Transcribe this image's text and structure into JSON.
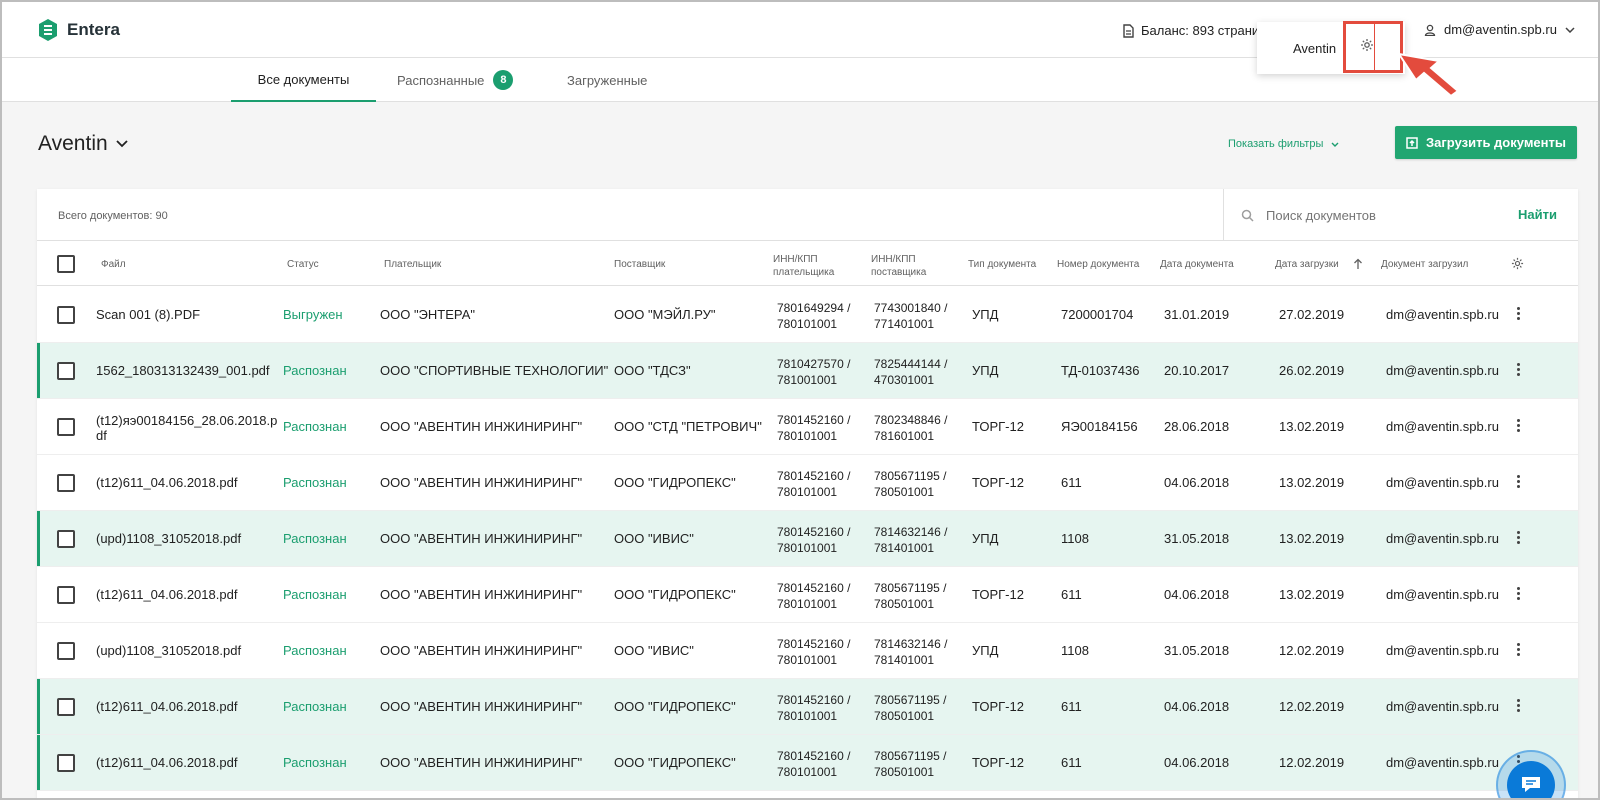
{
  "app": {
    "name": "Entera",
    "balance": "Баланс: 893 страни",
    "user_email": "dm@aventin.spb.ru",
    "dropdown_org": "Aventin"
  },
  "tabs": [
    {
      "label": "Все документы",
      "active": true
    },
    {
      "label": "Распознанные",
      "badge": "8"
    },
    {
      "label": "Загруженные"
    }
  ],
  "page": {
    "org_title": "Aventin",
    "filters_label": "Показать фильтры",
    "upload_label": "Загрузить документы"
  },
  "card": {
    "total_docs": "Всего документов: 90",
    "search_placeholder": "Поиск документов",
    "find_label": "Найти"
  },
  "columns": {
    "file": "Файл",
    "status": "Статус",
    "payer": "Плательщик",
    "supplier": "Поставщик",
    "payer_inn_line1": "ИНН/КПП",
    "payer_inn_line2": "плательщика",
    "supplier_inn_line1": "ИНН/КПП",
    "supplier_inn_line2": "поставщика",
    "doc_type": "Тип документа",
    "doc_number": "Номер документа",
    "doc_date": "Дата документа",
    "upload_date": "Дата загрузки",
    "uploaded_by": "Документ загрузил"
  },
  "rows": [
    {
      "file": "Scan 001 (8).PDF",
      "status": "Выгружен",
      "payer": "ООО \"ЭНТЕРА\"",
      "supplier": "ООО \"МЭЙЛ.РУ\"",
      "payer_inn": "7801649294 /",
      "payer_kpp": "780101001",
      "supplier_inn": "7743001840 /",
      "supplier_kpp": "771401001",
      "type": "УПД",
      "number": "7200001704",
      "doc_date": "31.01.2019",
      "upload_date": "27.02.2019",
      "uploaded_by": "dm@aventin.spb.ru",
      "highlight": false
    },
    {
      "file": "1562_180313132439_001.pdf",
      "status": "Распознан",
      "payer": "ООО \"СПОРТИВНЫЕ ТЕХНОЛОГИИ\"",
      "supplier": "ООО \"ТДСЗ\"",
      "payer_inn": "7810427570 /",
      "payer_kpp": "781001001",
      "supplier_inn": "7825444144 /",
      "supplier_kpp": "470301001",
      "type": "УПД",
      "number": "ТД-01037436",
      "doc_date": "20.10.2017",
      "upload_date": "26.02.2019",
      "uploaded_by": "dm@aventin.spb.ru",
      "highlight": true
    },
    {
      "file": "(t12)яэ00184156_28.06.2018.p",
      "file2": "df",
      "status": "Распознан",
      "payer": "ООО \"АВЕНТИН ИНЖИНИРИНГ\"",
      "supplier": "ООО \"СТД \"ПЕТРОВИЧ\"",
      "payer_inn": "7801452160 /",
      "payer_kpp": "780101001",
      "supplier_inn": "7802348846 /",
      "supplier_kpp": "781601001",
      "type": "ТОРГ-12",
      "number": "ЯЭ00184156",
      "doc_date": "28.06.2018",
      "upload_date": "13.02.2019",
      "uploaded_by": "dm@aventin.spb.ru",
      "highlight": false
    },
    {
      "file": "(t12)611_04.06.2018.pdf",
      "status": "Распознан",
      "payer": "ООО \"АВЕНТИН ИНЖИНИРИНГ\"",
      "supplier": "ООО \"ГИДРОПЕКС\"",
      "payer_inn": "7801452160 /",
      "payer_kpp": "780101001",
      "supplier_inn": "7805671195 /",
      "supplier_kpp": "780501001",
      "type": "ТОРГ-12",
      "number": "611",
      "doc_date": "04.06.2018",
      "upload_date": "13.02.2019",
      "uploaded_by": "dm@aventin.spb.ru",
      "highlight": false
    },
    {
      "file": "(upd)1108_31052018.pdf",
      "status": "Распознан",
      "payer": "ООО \"АВЕНТИН ИНЖИНИРИНГ\"",
      "supplier": "ООО \"ИВИС\"",
      "payer_inn": "7801452160 /",
      "payer_kpp": "780101001",
      "supplier_inn": "7814632146 /",
      "supplier_kpp": "781401001",
      "type": "УПД",
      "number": "1108",
      "doc_date": "31.05.2018",
      "upload_date": "13.02.2019",
      "uploaded_by": "dm@aventin.spb.ru",
      "highlight": true
    },
    {
      "file": "(t12)611_04.06.2018.pdf",
      "status": "Распознан",
      "payer": "ООО \"АВЕНТИН ИНЖИНИРИНГ\"",
      "supplier": "ООО \"ГИДРОПЕКС\"",
      "payer_inn": "7801452160 /",
      "payer_kpp": "780101001",
      "supplier_inn": "7805671195 /",
      "supplier_kpp": "780501001",
      "type": "ТОРГ-12",
      "number": "611",
      "doc_date": "04.06.2018",
      "upload_date": "13.02.2019",
      "uploaded_by": "dm@aventin.spb.ru",
      "highlight": false
    },
    {
      "file": "(upd)1108_31052018.pdf",
      "status": "Распознан",
      "payer": "ООО \"АВЕНТИН ИНЖИНИРИНГ\"",
      "supplier": "ООО \"ИВИС\"",
      "payer_inn": "7801452160 /",
      "payer_kpp": "780101001",
      "supplier_inn": "7814632146 /",
      "supplier_kpp": "781401001",
      "type": "УПД",
      "number": "1108",
      "doc_date": "31.05.2018",
      "upload_date": "12.02.2019",
      "uploaded_by": "dm@aventin.spb.ru",
      "highlight": false
    },
    {
      "file": "(t12)611_04.06.2018.pdf",
      "status": "Распознан",
      "payer": "ООО \"АВЕНТИН ИНЖИНИРИНГ\"",
      "supplier": "ООО \"ГИДРОПЕКС\"",
      "payer_inn": "7801452160 /",
      "payer_kpp": "780101001",
      "supplier_inn": "7805671195 /",
      "supplier_kpp": "780501001",
      "type": "ТОРГ-12",
      "number": "611",
      "doc_date": "04.06.2018",
      "upload_date": "12.02.2019",
      "uploaded_by": "dm@aventin.spb.ru",
      "highlight": true
    },
    {
      "file": "(t12)611_04.06.2018.pdf",
      "status": "Распознан",
      "payer": "ООО \"АВЕНТИН ИНЖИНИРИНГ\"",
      "supplier": "ООО \"ГИДРОПЕКС\"",
      "payer_inn": "7801452160 /",
      "payer_kpp": "780101001",
      "supplier_inn": "7805671195 /",
      "supplier_kpp": "780501001",
      "type": "ТОРГ-12",
      "number": "611",
      "doc_date": "04.06.2018",
      "upload_date": "12.02.2019",
      "uploaded_by": "dm@aventin.spb.ru",
      "highlight": true
    }
  ],
  "colors": {
    "accent": "#1b9e6f",
    "row_highlight": "#e6f5f0",
    "annotation_red": "#e34b3d",
    "chat_blue": "#0a7ad8"
  }
}
